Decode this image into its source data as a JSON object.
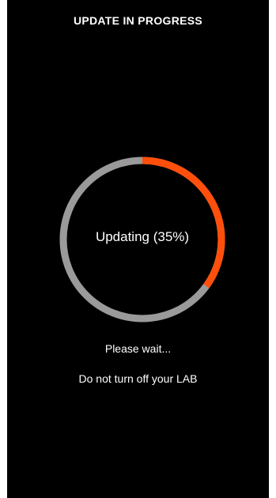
{
  "header": {
    "title": "UPDATE IN PROGRESS"
  },
  "progress": {
    "label": "Updating (35%)",
    "fraction": 0.35,
    "track_color": "#9a9a9a",
    "fill_color": "#ff4f0b"
  },
  "messages": {
    "wait": "Please wait...",
    "warning": "Do not turn off your LAB"
  }
}
